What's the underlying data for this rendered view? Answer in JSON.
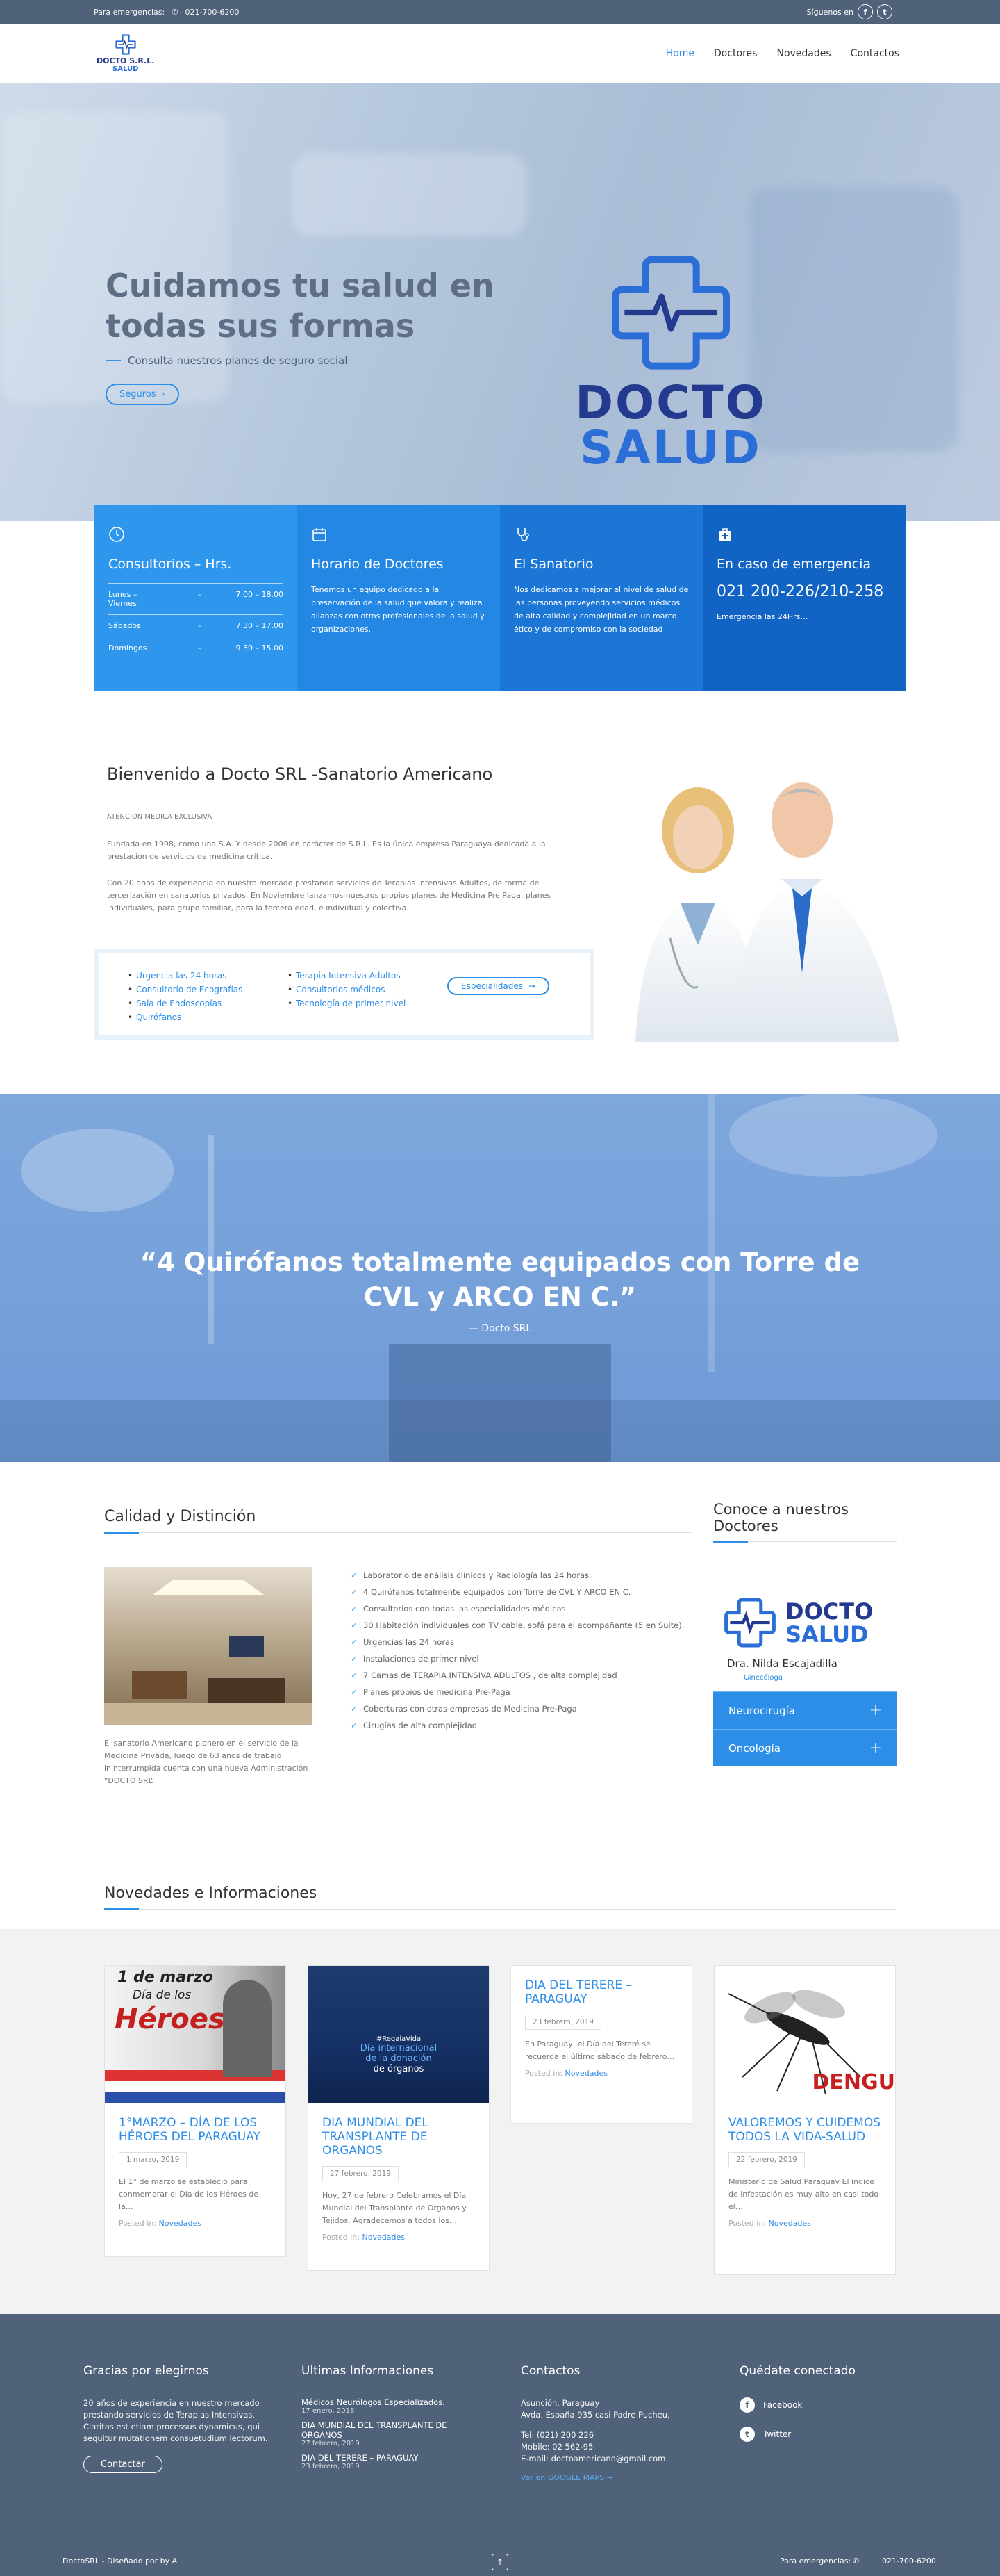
{
  "topbar": {
    "emergency_label": "Para emergencias:",
    "phone": "021-700-6200",
    "follow_label": "Síguenos en"
  },
  "header": {
    "logo_line1": "DOCTO S.R.L.",
    "logo_line2": "SALUD",
    "nav": [
      "Home",
      "Doctores",
      "Novedades",
      "Contactos"
    ]
  },
  "hero": {
    "title": "Cuidamos tu salud en todas sus formas",
    "subtitle": "Consulta nuestros planes de seguro social",
    "button": "Seguros",
    "logo_word1": "DOCTO",
    "logo_word2": "SALUD"
  },
  "info": {
    "box1": {
      "title": "Consultorios – Hrs.",
      "rows": [
        {
          "day": "Lunes – Viernes",
          "sep": "–",
          "hours": "7.00 – 18.00"
        },
        {
          "day": "Sábados",
          "sep": "–",
          "hours": "7.30 – 17.00"
        },
        {
          "day": "Domingos",
          "sep": "–",
          "hours": "9.30 – 15.00"
        }
      ]
    },
    "box2": {
      "title": "Horario de Doctores",
      "text": "Tenemos un equipo dedicado a la preservación de la salud que valora y realiza alianzas con otros profesionales de la salud y organizaciones."
    },
    "box3": {
      "title": "El Sanatorio",
      "text": "Nos dedicamos a mejorar el nivel de salud de las personas proveyendo servicios médicos de alta calidad y complejidad en un marco ético y de compromiso con la sociedad"
    },
    "box4": {
      "title": "En caso de emergencia",
      "phone": "021 200-226/210-258",
      "note": "Emergencia las 24Hrs…"
    },
    "colors": [
      "#2e96ec",
      "#2487e3",
      "#1b76d5",
      "#1264c4"
    ]
  },
  "welcome": {
    "title": "Bienvenido a Docto SRL -Sanatorio Americano",
    "small": "ATENCION MEDICA EXCLUSIVA",
    "p1": "Fundada en   1998, como una S.A. Y desde 2006 en carácter de S.R.L. Es la única empresa Paraguaya dedicada a la prestación de servicios de medicina crítica.",
    "p2": "Con 20 años  de experiencia en nuestro mercado  prestando servicios  de Terapias Intensivas Adultos, de forma de tercerización en sanatorios privados. En Noviembre lanzamos nuestros propios planes de Medicina Pre Paga, planes individuales,  para grupo familiar, para la tercera edad, e individual y colectiva.",
    "features_col1": [
      "Urgencia las 24 horas",
      "Consultorio de Ecografías",
      "Sala de Endoscopías",
      "Quirófanos"
    ],
    "features_col2": [
      "Terapia Intensiva Adultos",
      "Consultorios médicos",
      "Tecnología de primer nivel"
    ],
    "button": "Especialidades"
  },
  "quote": {
    "text": "“4 Quirófanos totalmente equipados con Torre de CVL y ARCO EN C.”",
    "by": "— Docto SRL"
  },
  "quality": {
    "title": "Calidad y Distinción",
    "caption": "El sanatorio Americano pionero en el servicio de la Medicina Privada, luego de 63 años de trabajo ininterrumpida cuenta con una nueva Administración “DOCTO SRL”",
    "list": [
      "Laboratorio de análisis clínicos y Radiología las 24 horas.",
      "4 Quirófanos   totalmente equipados  con Torre de  CVL  Y ARCO EN C.",
      "Consultorios con todas las especialidades médicas",
      "30 Habitación individuales con  TV cable, sofá para el acompañante (5 en Suite).",
      "Urgencias las 24 horas",
      "Instalaciones de primer nivel",
      "7  Camas de TERAPIA INTENSIVA ADULTOS , de alta complejidad",
      "Planes propios de medicina Pre-Paga",
      "Coberturas con otras empresas de Medicina Pre-Paga",
      "Cirugías de alta complejidad"
    ]
  },
  "doctors": {
    "title": "Conoce a nuestros Doctores",
    "logo_word1": "DOCTO",
    "logo_word2": "SALUD",
    "name": "Dra. Nilda Escajadilla",
    "specialty": "Ginecóloga",
    "accordion": [
      "Neurocirugía",
      "Oncología"
    ]
  },
  "news": {
    "title": "Novedades e Informaciones",
    "posted_in": "Posted in:",
    "category": "Novedades",
    "cards": [
      {
        "title": "1°MARZO – DÍA DE LOS HÉROES DEL PARAGUAY",
        "date": "1 marzo, 2019",
        "excerpt": "El 1° de marzo se estableció para conmemorar el Día de los Héroes de la…",
        "img_text1": "1 de marzo",
        "img_text2": "Día de los",
        "img_text3": "Héroes"
      },
      {
        "title": "DIA MUNDIAL DEL TRANSPLANTE DE ORGANOS",
        "date": "27 febrero, 2019",
        "excerpt": "Hoy, 27 de febrero Celebramos el Día Mundial del Transplante de Organos y Tejidos. Agradecemos a todos  los…",
        "img_text1": "#RegalaVida",
        "img_text2": "Día internacional",
        "img_text3": "de la donación",
        "img_text4": "de órganos"
      },
      {
        "title": "DIA DEL TERERE – PARAGUAY",
        "date": "23 febrero, 2019",
        "excerpt": "    En Paraguay, el Día del Tereré se recuerda el último sábado de febrero…"
      },
      {
        "title": "VALOREMOS Y CUIDEMOS TODOS LA VIDA-SALUD",
        "date": "22 febrero, 2019",
        "excerpt": "Ministerio de Salud Paraguay El índice de infestación es muy alto en casi todo el…",
        "img_text1": "DENGU"
      }
    ]
  },
  "footer": {
    "col1": {
      "title": "Gracias por elegirnos",
      "text": "20 años de experiencia en nuestro mercado prestando servicios de Terapias Intensivas. Claritas est etiam processus dynamicus, qui sequitur mutationem consuetudium lectorum.",
      "button": "Contactar"
    },
    "col2": {
      "title": "Ultimas Informaciones",
      "items": [
        {
          "t": "Médicos Neurólogos Especializados.",
          "d": "17 enero, 2018"
        },
        {
          "t": "DIA MUNDIAL DEL TRANSPLANTE DE ORGANOS",
          "d": "27 febrero, 2019"
        },
        {
          "t": "DIA DEL TERERE – PARAGUAY",
          "d": "23 febrero, 2019"
        }
      ]
    },
    "col3": {
      "title": "Contactos",
      "line1": "Asunción, Paraguay",
      "line2": "Avda. España 935 casi Padre Pucheu,",
      "tel": "Tel: (021) 200 226",
      "mobile": "Mobile: 02 562-95",
      "email": "E-mail: doctoamericano@gmail.com",
      "map": "Ver en GOOGLE MAPS →"
    },
    "col4": {
      "title": "Quédate conectado",
      "facebook": "Facebook",
      "twitter": "Twitter"
    },
    "bottom_left": "DoctoSRL - Diseñado por by A",
    "bottom_emergency": "Para emergencias:",
    "bottom_phone": "021-700-6200"
  }
}
